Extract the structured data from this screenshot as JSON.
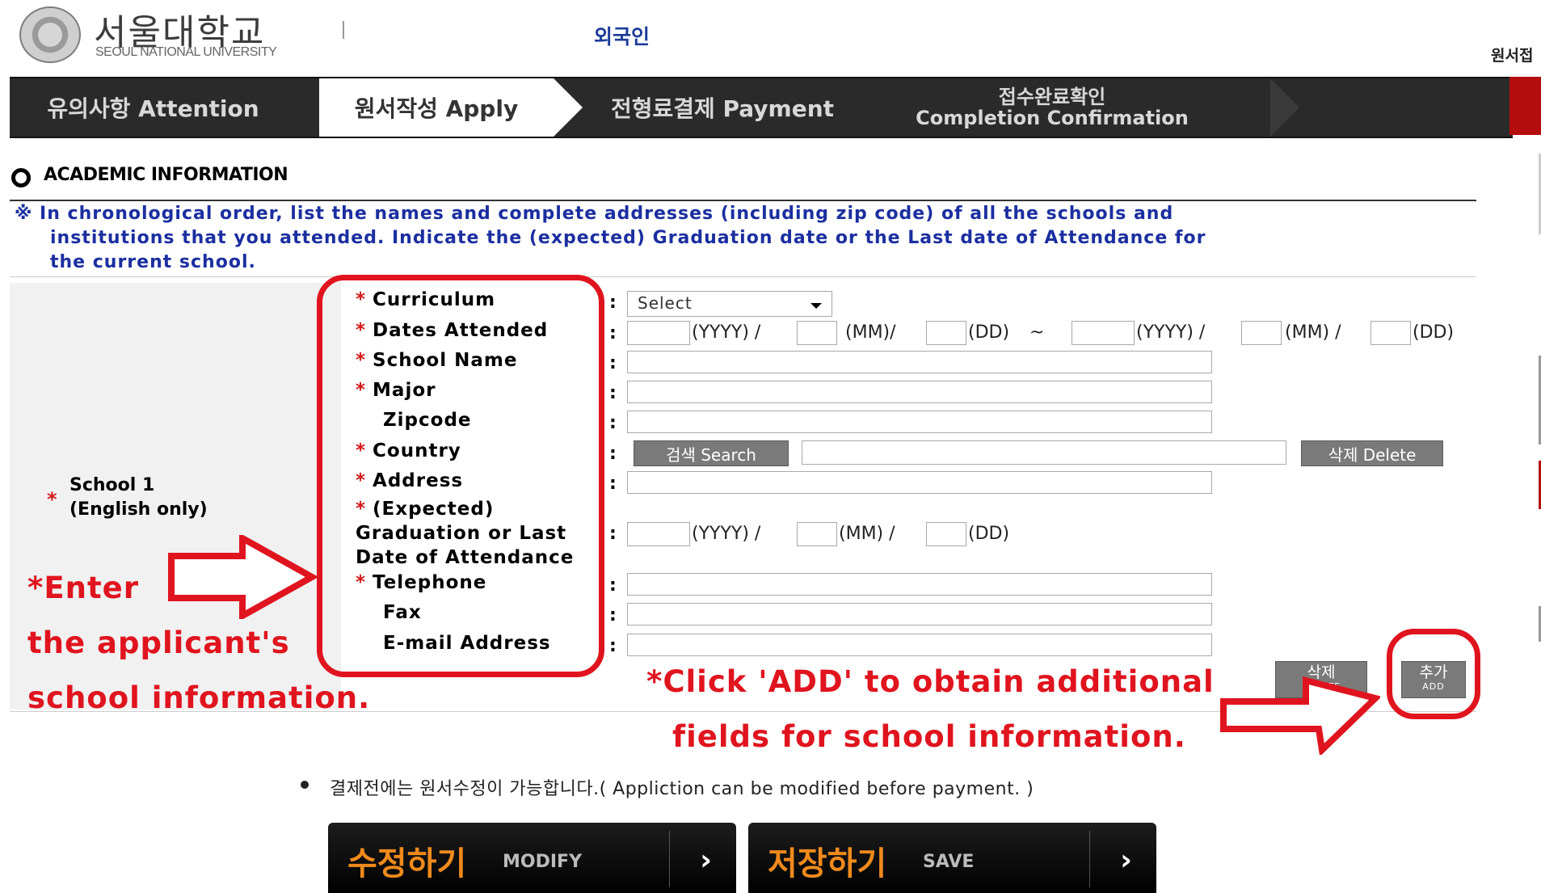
{
  "header": {
    "logo_kr": "서울대학교",
    "logo_en": "SEOUL NATIONAL UNIVERSITY",
    "foreign": "외국인",
    "corner_text": "원서접"
  },
  "nav": {
    "steps": [
      {
        "label": "유의사항 Attention"
      },
      {
        "label": "원서작성 Apply"
      },
      {
        "label": "전형료결제 Payment"
      },
      {
        "label_kr": "접수완료확인",
        "label_en": "Completion Confirmation"
      }
    ]
  },
  "section": {
    "title": "ACADEMIC INFORMATION",
    "notice_line1": "※ In chronological order, list the names and complete addresses (including zip code) of all the schools and",
    "notice_line2": "institutions that you attended. Indicate the (expected) Graduation date or the Last date of Attendance for",
    "notice_line3": "the current school."
  },
  "school": {
    "label_line1": "School 1",
    "label_line2": "(English only)"
  },
  "fields": {
    "curriculum": "Curriculum",
    "dates_attended": "Dates Attended",
    "school_name": "School Name",
    "major": "Major",
    "zipcode": "Zipcode",
    "country": "Country",
    "address": "Address",
    "grad_line1": "(Expected)",
    "grad_line2": "Graduation or Last",
    "grad_line3": "Date of Attendance",
    "telephone": "Telephone",
    "fax": "Fax",
    "email": "E-mail Address",
    "colon": ":",
    "select_value": "Select",
    "yyyy": "(YYYY) /",
    "mm1": "(MM)/",
    "dd": "(DD)",
    "tilde": "~",
    "mm2": "(MM) /",
    "search_button": "검색 Search",
    "delete_button": "삭제 Delete",
    "row_delete_kr": "삭제",
    "row_delete_en": "DELETE",
    "row_add_kr": "추가",
    "row_add_en": "ADD"
  },
  "annotations": {
    "enter_line1": "*Enter",
    "enter_line2": "the applicant's",
    "enter_line3": "school information.",
    "add_line1": "*Click 'ADD' to obtain additional",
    "add_line2": "fields for school information."
  },
  "footer": {
    "note": "결제전에는 원서수정이 가능합니다.( Appliction can be modified before payment. )",
    "modify_kr": "수정하기",
    "modify_en": "MODIFY",
    "save_kr": "저장하기",
    "save_en": "SAVE",
    "chevron": "›"
  },
  "colors": {
    "accent_red": "#e0141e",
    "nav_bg": "#2a2a2a",
    "notice_blue": "#1b2fa0",
    "button_orange": "#f08a1c"
  }
}
